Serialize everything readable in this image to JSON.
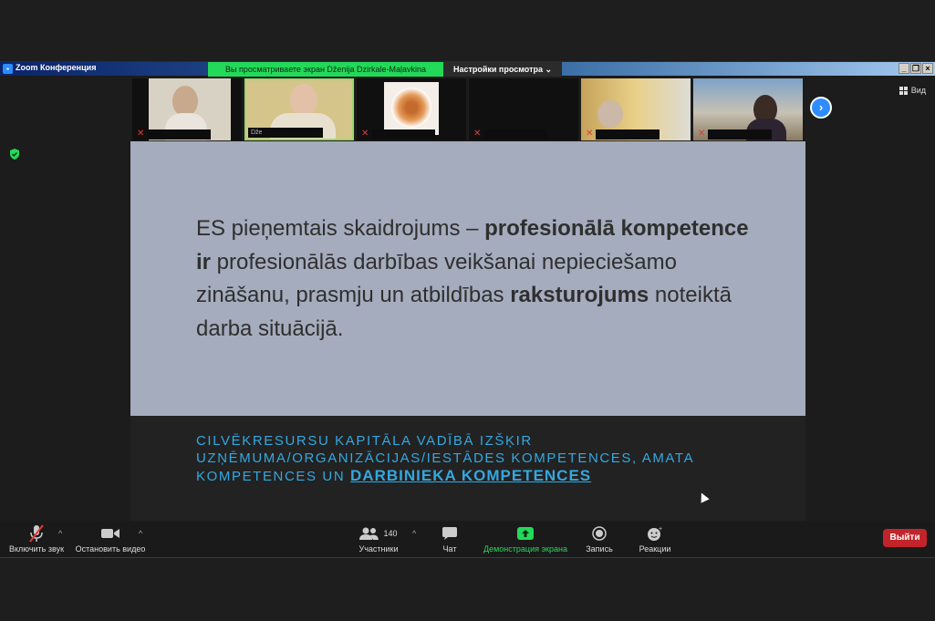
{
  "window": {
    "title": "Zoom Конференция",
    "share_banner": "Вы просматриваете экран Dženija Dzirkale-Maļavkina",
    "view_settings": "Настройки просмотра",
    "view_label": "Вид"
  },
  "participants_strip": [
    {
      "name": ""
    },
    {
      "name": "Dže"
    },
    {
      "name": ""
    },
    {
      "name": ""
    },
    {
      "name": ""
    },
    {
      "name": ""
    }
  ],
  "slide": {
    "p1": "ES pieņemtais skaidrojums – ",
    "b1": "profesionālā kompetence ir",
    "p2": " profesionālās darbības veikšanai nepieciešamo zināšanu, prasmju un atbildības ",
    "b2": "raksturojums",
    "p3": " noteiktā darba situācijā.",
    "sub_text": "CILVĒKRESURSU KAPITĀLA VADĪBĀ IZŠĶIR UZŅĒMUMA/ORGANIZĀCIJAS/IESTĀDES KOMPETENCES, AMATA KOMPETENCES UN ",
    "sub_emphasis": "DARBINIEKA KOMPETENCES"
  },
  "toolbar": {
    "unmute": "Включить звук",
    "stop_video": "Остановить видео",
    "participants": "Участники",
    "participants_count": "140",
    "chat": "Чат",
    "share_screen": "Демонстрация экрана",
    "record": "Запись",
    "reactions": "Реакции",
    "leave": "Выйти"
  },
  "colors": {
    "share_banner": "#23d959",
    "slide_bg": "#a5acbd",
    "slide_accent": "#33a8e0",
    "leave": "#c3242b"
  }
}
